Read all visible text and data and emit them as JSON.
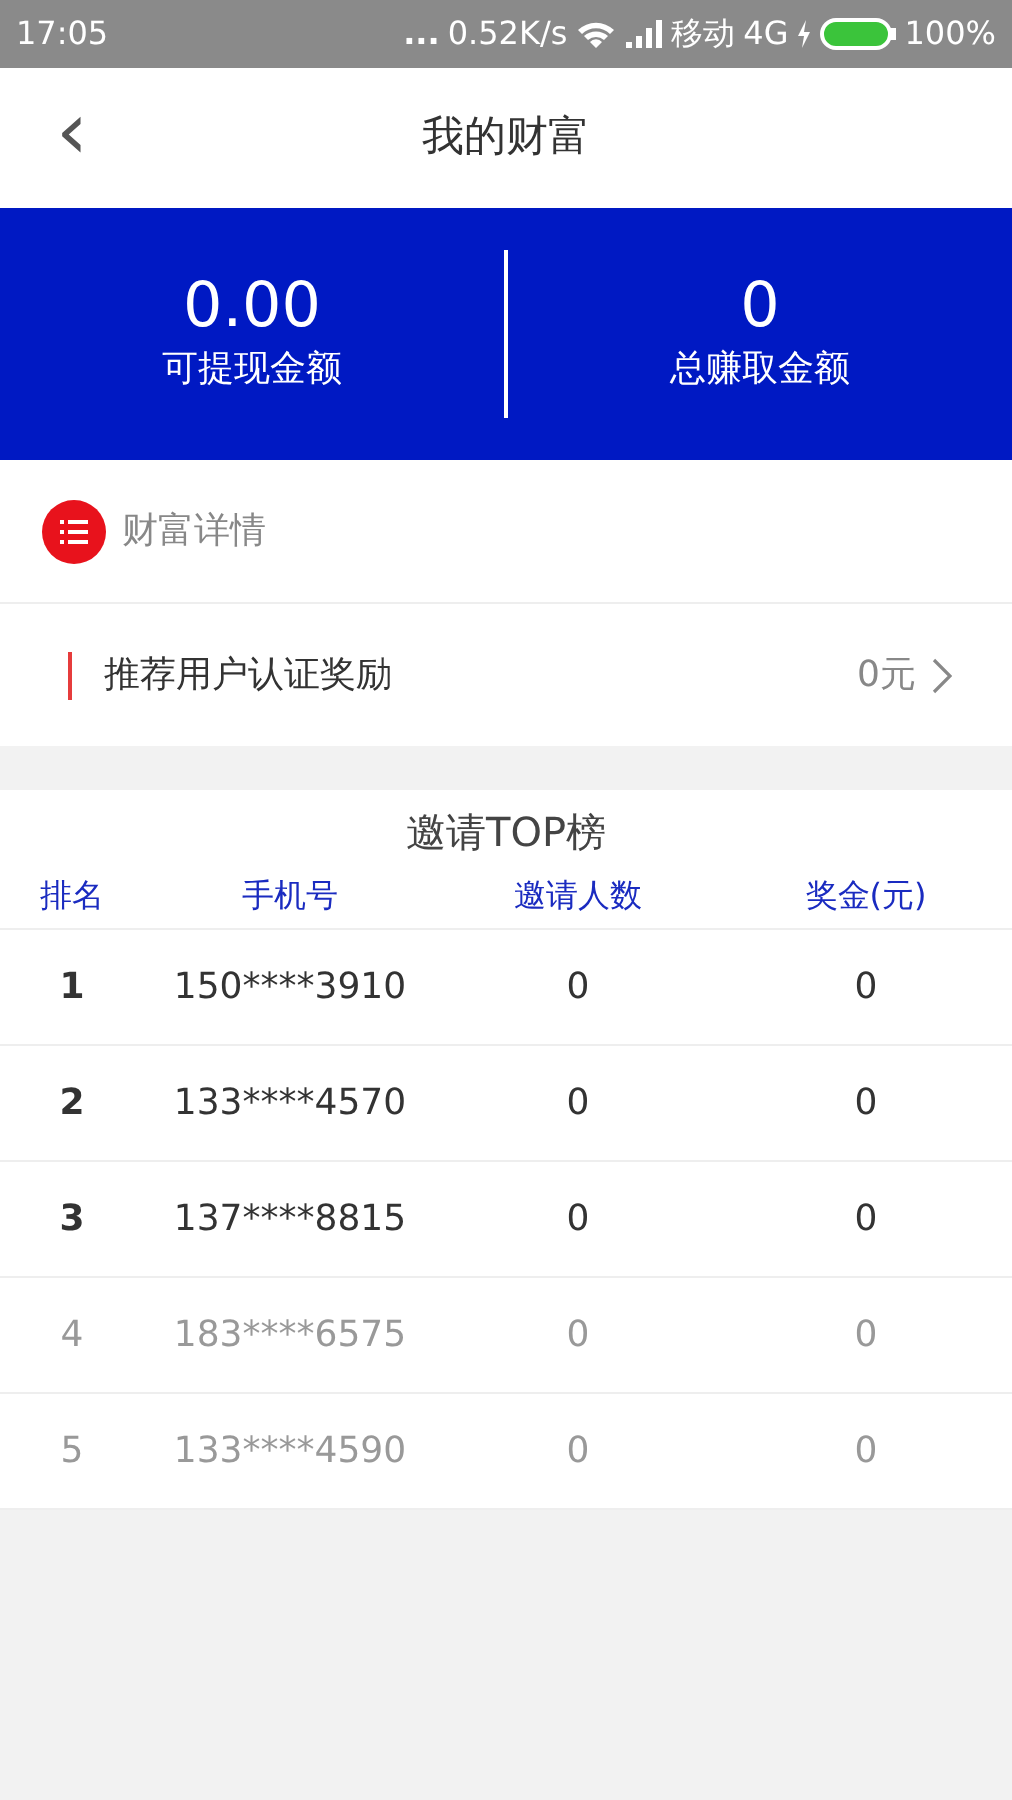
{
  "status_bar": {
    "time": "17:05",
    "dots": "...",
    "speed": "0.52K/s",
    "carrier": "移动",
    "network": "4G",
    "battery": "100%"
  },
  "header": {
    "back": "‹",
    "title": "我的财富"
  },
  "summary": [
    {
      "value": "0.00",
      "label": "可提现金额"
    },
    {
      "value": "0",
      "label": "总赚取金额"
    }
  ],
  "details": {
    "title": "财富详情"
  },
  "reward": {
    "label": "推荐用户认证奖励",
    "amount": "0元"
  },
  "ranking": {
    "title": "邀请TOP榜",
    "columns": [
      "排名",
      "手机号",
      "邀请人数",
      "奖金(元)"
    ],
    "rows": [
      {
        "highlighted": true,
        "cells": [
          "1",
          "150****3910",
          "0",
          "0"
        ]
      },
      {
        "highlighted": true,
        "cells": [
          "2",
          "133****4570",
          "0",
          "0"
        ]
      },
      {
        "highlighted": true,
        "cells": [
          "3",
          "137****8815",
          "0",
          "0"
        ]
      },
      {
        "highlighted": false,
        "cells": [
          "4",
          "183****6575",
          "0",
          "0"
        ]
      },
      {
        "highlighted": false,
        "cells": [
          "5",
          "133****4590",
          "0",
          "0"
        ]
      }
    ]
  }
}
